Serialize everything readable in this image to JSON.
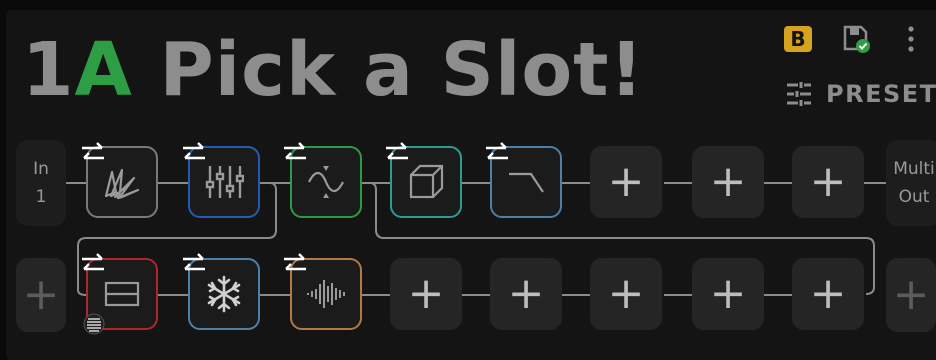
{
  "title": {
    "preset_num": "1",
    "preset_letter": "A",
    "name": "Pick a Slot!"
  },
  "header": {
    "badge": "B",
    "preset_label": "PRESET"
  },
  "row1": {
    "input_label": "In",
    "input_num": "1",
    "output_line1": "Multi",
    "output_line2": "Out"
  },
  "row1_blocks": [
    {
      "icon": "distortion-fan-icon",
      "border": "#7a7a7a"
    },
    {
      "icon": "eq-sliders-icon",
      "border": "#1f5fae"
    },
    {
      "icon": "modulation-wave-icon",
      "border": "#2f9a45"
    },
    {
      "icon": "cab-cube-icon",
      "border": "#2b9d95"
    },
    {
      "icon": "filter-curve-icon",
      "border": "#4d7fa8"
    }
  ],
  "row2_blocks": [
    {
      "icon": "dynamics-box-icon",
      "border": "#b0262a"
    },
    {
      "icon": "freeze-snowflake-icon",
      "border": "#4d7fa8"
    },
    {
      "icon": "reverb-waveform-icon",
      "border": "#b07a45"
    }
  ],
  "empty_slot_glyph": "+"
}
